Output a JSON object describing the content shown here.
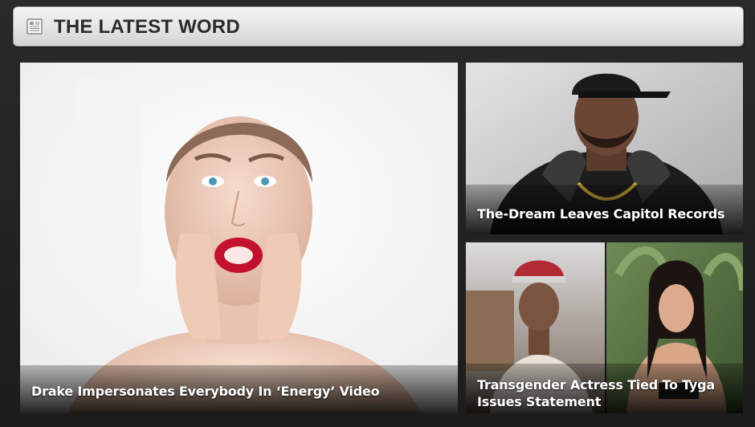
{
  "section": {
    "title": "THE LATEST WORD",
    "icon": "newspaper-icon"
  },
  "stories": [
    {
      "headline": "Drake Impersonates Everybody In ‘Energy’ Video"
    },
    {
      "headline": "The-Dream Leaves Capitol Records"
    },
    {
      "headline": "Transgender Actress Tied To Tyga Issues Statement"
    }
  ],
  "colors": {
    "background": "#232323",
    "header_bar": "#e6e6e6",
    "header_text": "#2b2b2b",
    "caption_text": "#ffffff"
  }
}
